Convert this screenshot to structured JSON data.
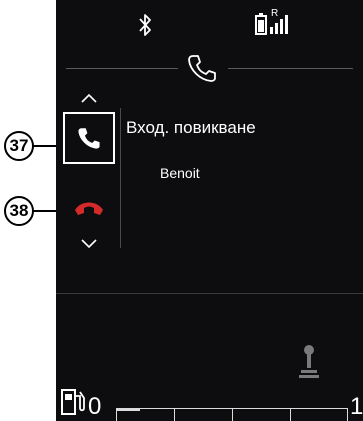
{
  "status_bar": {
    "bluetooth_icon": "bluetooth-icon",
    "battery_signal_icon": "phone-battery-signal-icon",
    "roaming_label": "R"
  },
  "header": {
    "phone_icon": "phone-handset-icon"
  },
  "call_panel": {
    "title": "Вход. повикване",
    "caller": "Benoit",
    "answer_icon": "answer-call-icon",
    "reject_icon": "reject-call-icon",
    "scroll_up_icon": "chevron-up-icon",
    "scroll_down_icon": "chevron-down-icon"
  },
  "callouts": {
    "answer_number": "37",
    "reject_number": "38"
  },
  "bottom_bar": {
    "fuel_icon": "fuel-pump-icon",
    "gauge_start": "0",
    "gauge_end": "1",
    "gear_icon": "gear-shift-indicator-icon"
  },
  "colors": {
    "screen_background": "#0d0d0f",
    "text": "#ffffff",
    "reject_red": "#d42a2a",
    "divider": "#5a5a5a"
  }
}
